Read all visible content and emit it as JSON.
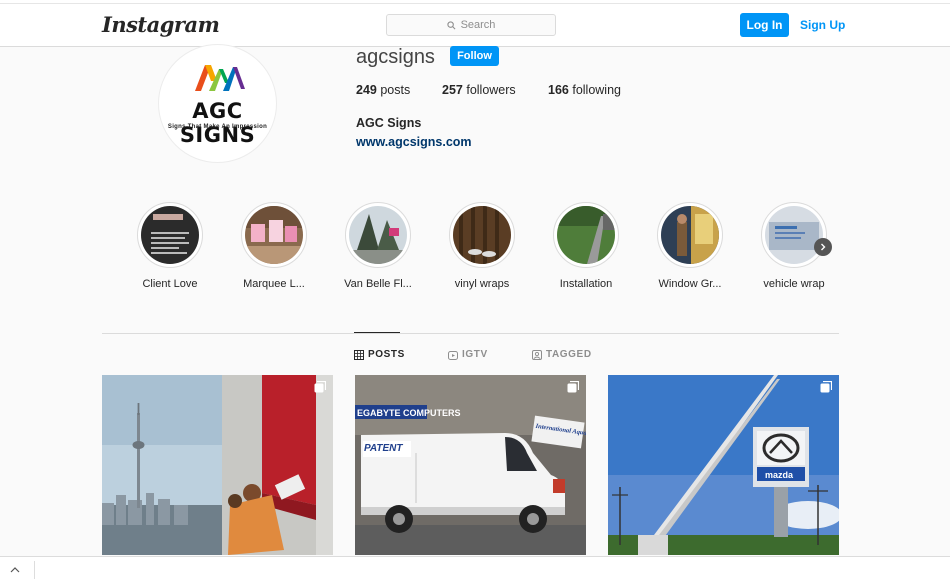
{
  "nav": {
    "logo": "Instagram",
    "search_placeholder": "Search",
    "login_label": "Log In",
    "signup_label": "Sign Up",
    "accent": "#0095f6"
  },
  "profile": {
    "username": "agcsigns",
    "follow_label": "Follow",
    "posts_count": "249",
    "posts_label": "posts",
    "followers_count": "257",
    "followers_label": "followers",
    "following_count": "166",
    "following_label": "following",
    "full_name": "AGC Signs",
    "website": "www.agcsigns.com",
    "avatar_brand": "AGC SIGNS",
    "avatar_tagline": "Signs That Make An Impression"
  },
  "highlights": [
    {
      "label": "Client Love",
      "icon": "highlight-thumb"
    },
    {
      "label": "Marquee L...",
      "icon": "highlight-thumb"
    },
    {
      "label": "Van Belle Fl...",
      "icon": "highlight-thumb"
    },
    {
      "label": "vinyl wraps",
      "icon": "highlight-thumb"
    },
    {
      "label": "Installation",
      "icon": "highlight-thumb"
    },
    {
      "label": "Window Gr...",
      "icon": "highlight-thumb"
    },
    {
      "label": "vehicle wrap",
      "icon": "highlight-thumb"
    }
  ],
  "tabs": [
    {
      "label": "POSTS",
      "icon": "grid-icon",
      "active": true
    },
    {
      "label": "IGTV",
      "icon": "igtv-icon",
      "active": false
    },
    {
      "label": "TAGGED",
      "icon": "tagged-icon",
      "active": false
    }
  ],
  "posts": {
    "post2_sign": "EGABYTE COMPUTERS",
    "post2_van_text": "PATENT",
    "post2_side_sign": "International Aquatic Pools",
    "post3_sign": "mazda"
  }
}
